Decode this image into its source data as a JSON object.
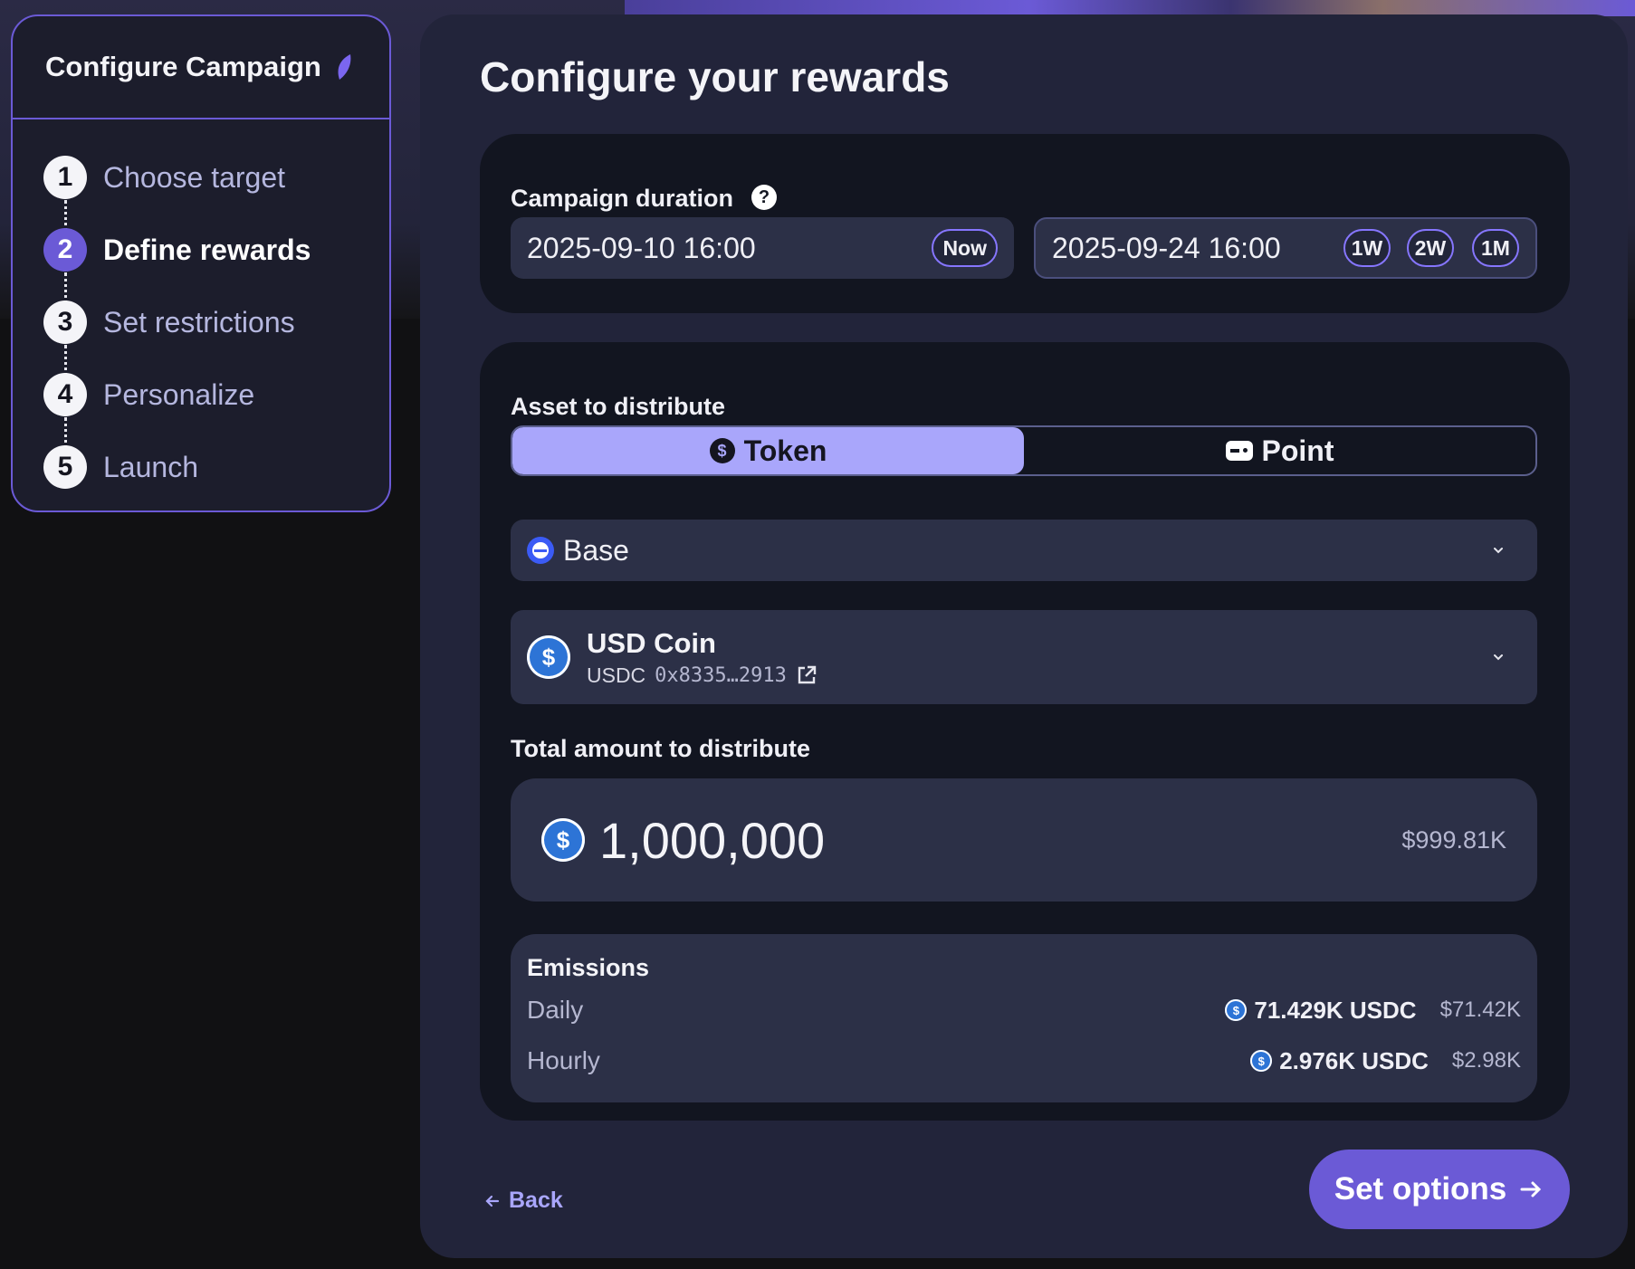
{
  "sidebar": {
    "title": "Configure Campaign",
    "steps": [
      {
        "num": "1",
        "label": "Choose target"
      },
      {
        "num": "2",
        "label": "Define rewards"
      },
      {
        "num": "3",
        "label": "Set restrictions"
      },
      {
        "num": "4",
        "label": "Personalize"
      },
      {
        "num": "5",
        "label": "Launch"
      }
    ]
  },
  "main": {
    "title": "Configure your rewards",
    "duration": {
      "label": "Campaign duration",
      "start": "2025-09-10 16:00",
      "now_label": "Now",
      "end": "2025-09-24 16:00",
      "presets": [
        "1W",
        "2W",
        "1M"
      ]
    },
    "asset": {
      "label": "Asset to distribute",
      "tabs": {
        "token": "Token",
        "point": "Point"
      },
      "network": "Base",
      "token_name": "USD Coin",
      "token_symbol": "USDC",
      "token_address": "0x8335…2913"
    },
    "amount": {
      "label": "Total amount to distribute",
      "value": "1,000,000",
      "usd": "$999.81K"
    },
    "emissions": {
      "title": "Emissions",
      "rows": [
        {
          "label": "Daily",
          "amount": "71.429K USDC",
          "usd": "$71.42K"
        },
        {
          "label": "Hourly",
          "amount": "2.976K USDC",
          "usd": "$2.98K"
        }
      ]
    },
    "back_label": "Back",
    "next_label": "Set options"
  },
  "colors": {
    "accent": "#6b5ad6",
    "accent_light": "#a9a6fb",
    "panel": "#22243a",
    "card": "#121520",
    "field": "#2c3047"
  },
  "icons": {
    "title": "leaf-icon",
    "help": "question-icon",
    "token": "dollar-coin-icon",
    "point": "gamepad-icon",
    "network": "base-network-icon",
    "usdc": "usdc-icon",
    "external": "external-link-icon",
    "chevron": "chevron-down-icon",
    "back": "arrow-left-icon",
    "next": "arrow-right-icon"
  }
}
